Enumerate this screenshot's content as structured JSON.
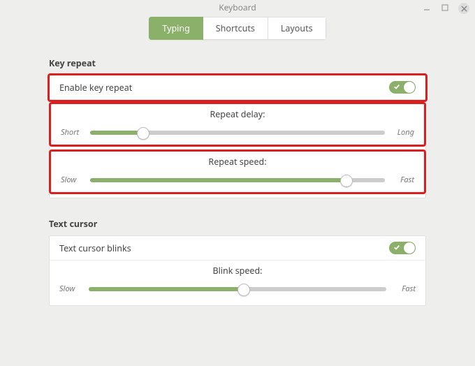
{
  "window": {
    "title": "Keyboard"
  },
  "tabs": {
    "typing": "Typing",
    "shortcuts": "Shortcuts",
    "layouts": "Layouts"
  },
  "keyRepeat": {
    "heading": "Key repeat",
    "enableLabel": "Enable key repeat",
    "enabled": true,
    "delay": {
      "title": "Repeat delay:",
      "leftLabel": "Short",
      "rightLabel": "Long",
      "percent": 18
    },
    "speed": {
      "title": "Repeat speed:",
      "leftLabel": "Slow",
      "rightLabel": "Fast",
      "percent": 87
    }
  },
  "textCursor": {
    "heading": "Text cursor",
    "enableLabel": "Text cursor blinks",
    "enabled": true,
    "speed": {
      "title": "Blink speed:",
      "leftLabel": "Slow",
      "rightLabel": "Fast",
      "percent": 52
    }
  }
}
